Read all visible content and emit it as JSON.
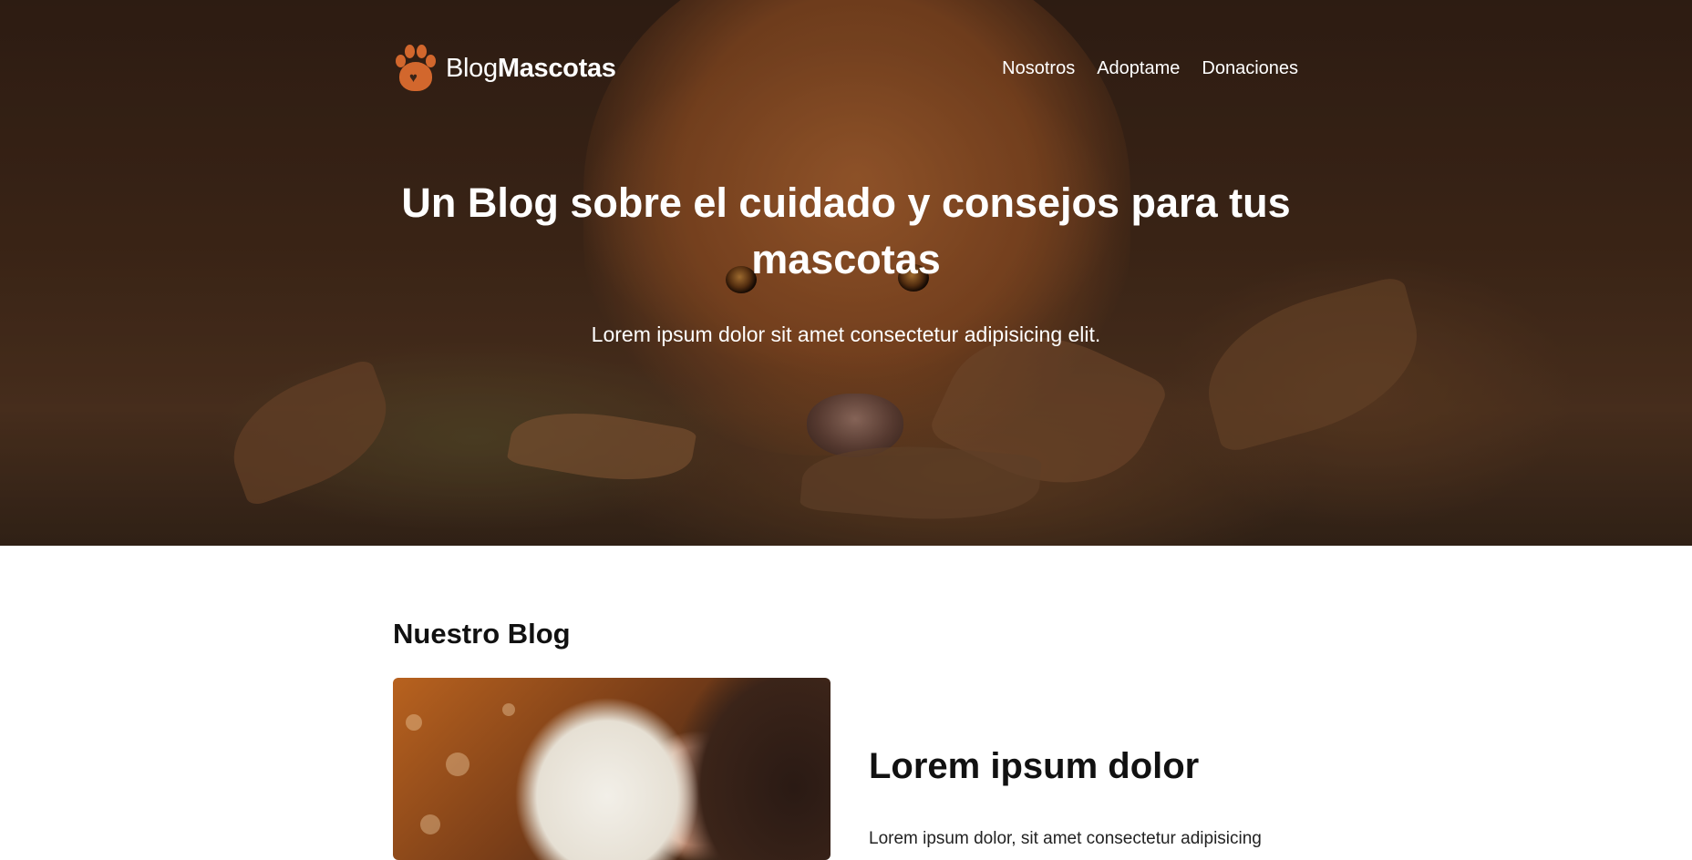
{
  "brand": {
    "logo_light": "Blog",
    "logo_bold": "Mascotas",
    "accent_color": "#d2672d"
  },
  "nav": {
    "items": [
      {
        "label": "Nosotros"
      },
      {
        "label": "Adoptame"
      },
      {
        "label": "Donaciones"
      }
    ]
  },
  "hero": {
    "title": "Un Blog sobre el cuidado y consejos para tus mascotas",
    "subtitle": "Lorem ipsum dolor sit amet consectetur adipisicing elit.",
    "image_icon": "dog-photo"
  },
  "blog": {
    "section_title": "Nuestro Blog",
    "posts": [
      {
        "title": "Lorem ipsum dolor",
        "excerpt": "Lorem ipsum dolor, sit amet consectetur adipisicing",
        "image_icon": "woman-with-dog-photo"
      }
    ]
  }
}
